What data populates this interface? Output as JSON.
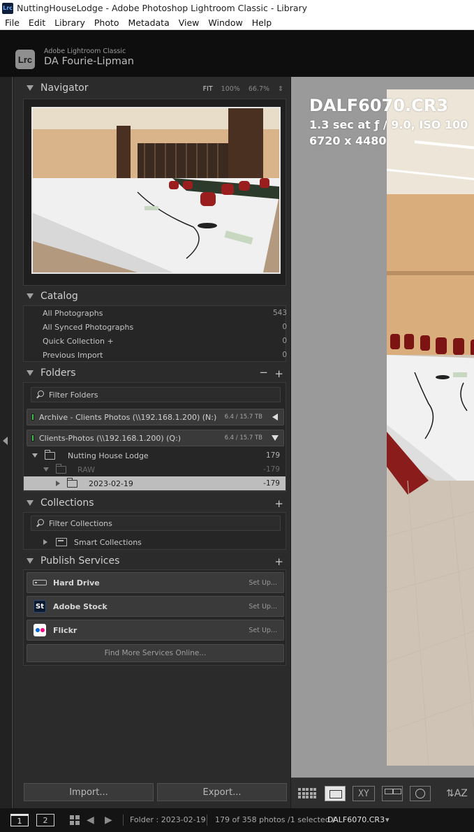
{
  "window": {
    "title": "NuttingHouseLodge - Adobe Photoshop Lightroom Classic - Library",
    "app_icon": "Lrc"
  },
  "menu": [
    "File",
    "Edit",
    "Library",
    "Photo",
    "Metadata",
    "View",
    "Window",
    "Help"
  ],
  "identity": {
    "badge": "Lrc",
    "product": "Adobe Lightroom Classic",
    "user": "DA Fourie-Lipman"
  },
  "navigator": {
    "title": "Navigator",
    "zoom_fit": "FIT",
    "zoom_100": "100%",
    "zoom_667": "66.7%"
  },
  "catalog": {
    "title": "Catalog",
    "items": [
      {
        "label": "All Photographs",
        "count": "543"
      },
      {
        "label": "All Synced Photographs",
        "count": "0"
      },
      {
        "label": "Quick Collection  +",
        "count": "0"
      },
      {
        "label": "Previous Import",
        "count": "0"
      }
    ]
  },
  "folders": {
    "title": "Folders",
    "filter_placeholder": "Filter Folders",
    "volumes": [
      {
        "name": "Archive - Clients Photos (\\\\192.168.1.200) (N:)",
        "size": "6.4 / 15.7 TB"
      },
      {
        "name": "Clients-Photos (\\\\192.168.1.200) (Q:)",
        "size": "6.4 / 15.7 TB"
      }
    ],
    "tree": [
      {
        "name": "Nutting House Lodge",
        "count": "179"
      },
      {
        "name": "RAW",
        "count": "-179"
      },
      {
        "name": "2023-02-19",
        "count": "-179"
      }
    ]
  },
  "collections": {
    "title": "Collections",
    "filter_placeholder": "Filter Collections",
    "smart": "Smart Collections"
  },
  "publish": {
    "title": "Publish Services",
    "services": [
      {
        "name": "Hard Drive",
        "action": "Set Up..."
      },
      {
        "name": "Adobe Stock",
        "action": "Set Up..."
      },
      {
        "name": "Flickr",
        "action": "Set Up..."
      }
    ],
    "find_more": "Find More Services Online..."
  },
  "buttons": {
    "import": "Import...",
    "export": "Export..."
  },
  "photo_info": {
    "filename": "DALF6070.CR3",
    "exposure": "1.3 sec at ƒ / 9.0, ISO 100",
    "dimensions": "6720 x 4480"
  },
  "toolbar": {
    "xy": "XY",
    "sort": "⇅AZ"
  },
  "filmstrip": {
    "screen1": "1",
    "screen2": "2",
    "folder": "Folder : 2023-02-19",
    "count": "179 of 358 photos /1 selected /",
    "current": "DALF6070.CR3",
    "dropdown": "▾"
  }
}
